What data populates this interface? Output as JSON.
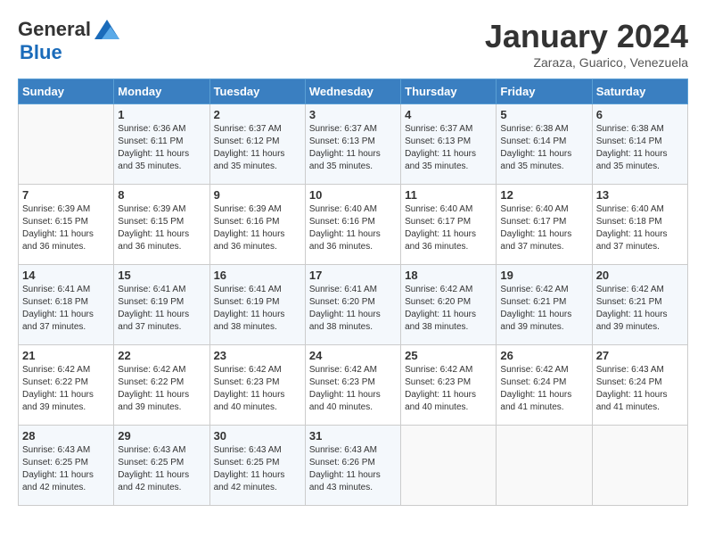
{
  "header": {
    "logo_general": "General",
    "logo_blue": "Blue",
    "month_title": "January 2024",
    "subtitle": "Zaraza, Guarico, Venezuela"
  },
  "weekdays": [
    "Sunday",
    "Monday",
    "Tuesday",
    "Wednesday",
    "Thursday",
    "Friday",
    "Saturday"
  ],
  "weeks": [
    [
      {
        "day": "",
        "sunrise": "",
        "sunset": "",
        "daylight": ""
      },
      {
        "day": "1",
        "sunrise": "Sunrise: 6:36 AM",
        "sunset": "Sunset: 6:11 PM",
        "daylight": "Daylight: 11 hours and 35 minutes."
      },
      {
        "day": "2",
        "sunrise": "Sunrise: 6:37 AM",
        "sunset": "Sunset: 6:12 PM",
        "daylight": "Daylight: 11 hours and 35 minutes."
      },
      {
        "day": "3",
        "sunrise": "Sunrise: 6:37 AM",
        "sunset": "Sunset: 6:13 PM",
        "daylight": "Daylight: 11 hours and 35 minutes."
      },
      {
        "day": "4",
        "sunrise": "Sunrise: 6:37 AM",
        "sunset": "Sunset: 6:13 PM",
        "daylight": "Daylight: 11 hours and 35 minutes."
      },
      {
        "day": "5",
        "sunrise": "Sunrise: 6:38 AM",
        "sunset": "Sunset: 6:14 PM",
        "daylight": "Daylight: 11 hours and 35 minutes."
      },
      {
        "day": "6",
        "sunrise": "Sunrise: 6:38 AM",
        "sunset": "Sunset: 6:14 PM",
        "daylight": "Daylight: 11 hours and 35 minutes."
      }
    ],
    [
      {
        "day": "7",
        "sunrise": "Sunrise: 6:39 AM",
        "sunset": "Sunset: 6:15 PM",
        "daylight": "Daylight: 11 hours and 36 minutes."
      },
      {
        "day": "8",
        "sunrise": "Sunrise: 6:39 AM",
        "sunset": "Sunset: 6:15 PM",
        "daylight": "Daylight: 11 hours and 36 minutes."
      },
      {
        "day": "9",
        "sunrise": "Sunrise: 6:39 AM",
        "sunset": "Sunset: 6:16 PM",
        "daylight": "Daylight: 11 hours and 36 minutes."
      },
      {
        "day": "10",
        "sunrise": "Sunrise: 6:40 AM",
        "sunset": "Sunset: 6:16 PM",
        "daylight": "Daylight: 11 hours and 36 minutes."
      },
      {
        "day": "11",
        "sunrise": "Sunrise: 6:40 AM",
        "sunset": "Sunset: 6:17 PM",
        "daylight": "Daylight: 11 hours and 36 minutes."
      },
      {
        "day": "12",
        "sunrise": "Sunrise: 6:40 AM",
        "sunset": "Sunset: 6:17 PM",
        "daylight": "Daylight: 11 hours and 37 minutes."
      },
      {
        "day": "13",
        "sunrise": "Sunrise: 6:40 AM",
        "sunset": "Sunset: 6:18 PM",
        "daylight": "Daylight: 11 hours and 37 minutes."
      }
    ],
    [
      {
        "day": "14",
        "sunrise": "Sunrise: 6:41 AM",
        "sunset": "Sunset: 6:18 PM",
        "daylight": "Daylight: 11 hours and 37 minutes."
      },
      {
        "day": "15",
        "sunrise": "Sunrise: 6:41 AM",
        "sunset": "Sunset: 6:19 PM",
        "daylight": "Daylight: 11 hours and 37 minutes."
      },
      {
        "day": "16",
        "sunrise": "Sunrise: 6:41 AM",
        "sunset": "Sunset: 6:19 PM",
        "daylight": "Daylight: 11 hours and 38 minutes."
      },
      {
        "day": "17",
        "sunrise": "Sunrise: 6:41 AM",
        "sunset": "Sunset: 6:20 PM",
        "daylight": "Daylight: 11 hours and 38 minutes."
      },
      {
        "day": "18",
        "sunrise": "Sunrise: 6:42 AM",
        "sunset": "Sunset: 6:20 PM",
        "daylight": "Daylight: 11 hours and 38 minutes."
      },
      {
        "day": "19",
        "sunrise": "Sunrise: 6:42 AM",
        "sunset": "Sunset: 6:21 PM",
        "daylight": "Daylight: 11 hours and 39 minutes."
      },
      {
        "day": "20",
        "sunrise": "Sunrise: 6:42 AM",
        "sunset": "Sunset: 6:21 PM",
        "daylight": "Daylight: 11 hours and 39 minutes."
      }
    ],
    [
      {
        "day": "21",
        "sunrise": "Sunrise: 6:42 AM",
        "sunset": "Sunset: 6:22 PM",
        "daylight": "Daylight: 11 hours and 39 minutes."
      },
      {
        "day": "22",
        "sunrise": "Sunrise: 6:42 AM",
        "sunset": "Sunset: 6:22 PM",
        "daylight": "Daylight: 11 hours and 39 minutes."
      },
      {
        "day": "23",
        "sunrise": "Sunrise: 6:42 AM",
        "sunset": "Sunset: 6:23 PM",
        "daylight": "Daylight: 11 hours and 40 minutes."
      },
      {
        "day": "24",
        "sunrise": "Sunrise: 6:42 AM",
        "sunset": "Sunset: 6:23 PM",
        "daylight": "Daylight: 11 hours and 40 minutes."
      },
      {
        "day": "25",
        "sunrise": "Sunrise: 6:42 AM",
        "sunset": "Sunset: 6:23 PM",
        "daylight": "Daylight: 11 hours and 40 minutes."
      },
      {
        "day": "26",
        "sunrise": "Sunrise: 6:42 AM",
        "sunset": "Sunset: 6:24 PM",
        "daylight": "Daylight: 11 hours and 41 minutes."
      },
      {
        "day": "27",
        "sunrise": "Sunrise: 6:43 AM",
        "sunset": "Sunset: 6:24 PM",
        "daylight": "Daylight: 11 hours and 41 minutes."
      }
    ],
    [
      {
        "day": "28",
        "sunrise": "Sunrise: 6:43 AM",
        "sunset": "Sunset: 6:25 PM",
        "daylight": "Daylight: 11 hours and 42 minutes."
      },
      {
        "day": "29",
        "sunrise": "Sunrise: 6:43 AM",
        "sunset": "Sunset: 6:25 PM",
        "daylight": "Daylight: 11 hours and 42 minutes."
      },
      {
        "day": "30",
        "sunrise": "Sunrise: 6:43 AM",
        "sunset": "Sunset: 6:25 PM",
        "daylight": "Daylight: 11 hours and 42 minutes."
      },
      {
        "day": "31",
        "sunrise": "Sunrise: 6:43 AM",
        "sunset": "Sunset: 6:26 PM",
        "daylight": "Daylight: 11 hours and 43 minutes."
      },
      {
        "day": "",
        "sunrise": "",
        "sunset": "",
        "daylight": ""
      },
      {
        "day": "",
        "sunrise": "",
        "sunset": "",
        "daylight": ""
      },
      {
        "day": "",
        "sunrise": "",
        "sunset": "",
        "daylight": ""
      }
    ]
  ]
}
